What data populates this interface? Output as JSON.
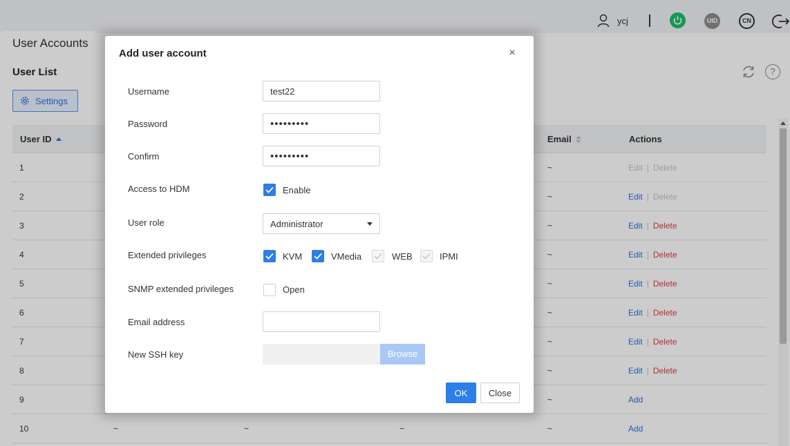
{
  "header": {
    "username": "ycj",
    "uid_label": "UID",
    "lang_label": "CN",
    "icons": [
      "user-icon",
      "power-icon",
      "uid-icon",
      "language-icon",
      "logout-icon"
    ],
    "power_color": "#19be6b"
  },
  "tab": {
    "label": "User Accounts"
  },
  "page": {
    "section_title": "User List",
    "settings_label": "Settings",
    "help_label": "?"
  },
  "table": {
    "columns": {
      "user_id": "User ID",
      "email": "Email",
      "actions": "Actions"
    },
    "action_labels": {
      "edit": "Edit",
      "delete": "Delete",
      "add": "Add"
    },
    "rows": [
      {
        "id": "1",
        "email": "~",
        "actions": "edit-delete-disabled"
      },
      {
        "id": "2",
        "email": "~",
        "actions": "edit-delete-disabled-delete"
      },
      {
        "id": "3",
        "email": "~",
        "actions": "edit-delete"
      },
      {
        "id": "4",
        "email": "~",
        "actions": "edit-delete"
      },
      {
        "id": "5",
        "email": "~",
        "actions": "edit-delete"
      },
      {
        "id": "6",
        "email": "~",
        "actions": "edit-delete"
      },
      {
        "id": "7",
        "email": "~",
        "actions": "edit-delete"
      },
      {
        "id": "8",
        "email": "~",
        "actions": "edit-delete"
      },
      {
        "id": "9",
        "email": "~",
        "actions": "add"
      },
      {
        "id": "10",
        "email": "~",
        "actions": "add",
        "col2": "~",
        "col3": "~",
        "col4": "~"
      }
    ]
  },
  "modal": {
    "title": "Add user account",
    "close_symbol": "×",
    "fields": {
      "username_label": "Username",
      "username_value": "test22",
      "password_label": "Password",
      "password_value": "•••••••••",
      "confirm_label": "Confirm",
      "confirm_value": "•••••••••",
      "hdm_label": "Access to HDM",
      "hdm_option": "Enable",
      "role_label": "User role",
      "role_value": "Administrator",
      "ext_label": "Extended privileges",
      "ext_kvm": "KVM",
      "ext_vmedia": "VMedia",
      "ext_web": "WEB",
      "ext_ipmi": "IPMI",
      "snmp_label": "SNMP extended privileges",
      "snmp_option": "Open",
      "email_label": "Email address",
      "email_value": "",
      "ssh_label": "New SSH key",
      "browse_label": "Browse"
    },
    "ok_label": "OK",
    "close_label": "Close",
    "accent_color": "#2d7ee8"
  }
}
